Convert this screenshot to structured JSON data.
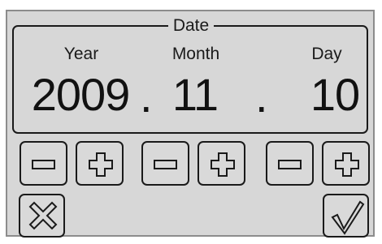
{
  "dialog": {
    "legend": "Date",
    "fields": [
      {
        "label": "Year",
        "value": "2009"
      },
      {
        "label": "Month",
        "value": "11"
      },
      {
        "label": "Day",
        "value": "10"
      }
    ],
    "separator": "."
  },
  "icons": {
    "decrement": "minus-icon",
    "increment": "plus-icon",
    "cancel": "x-icon",
    "confirm": "checkmark-icon"
  }
}
